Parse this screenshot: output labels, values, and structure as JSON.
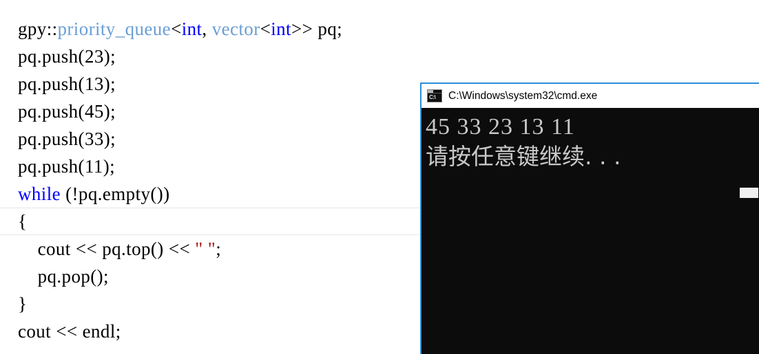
{
  "editor": {
    "language": "cpp",
    "background_color": "#ffffff",
    "foreground_color": "#000000",
    "current_line_highlight_color": "#e6e6e6",
    "token_colors": {
      "keyword": "#0000ff",
      "type": "#6a9fd4",
      "string": "#a31515",
      "plain": "#000000"
    },
    "lines": [
      {
        "id": "line-1",
        "current": false,
        "segments": [
          {
            "text": "gpy::",
            "token": "plain"
          },
          {
            "text": "priority_queue",
            "token": "class"
          },
          {
            "text": "<",
            "token": "plain"
          },
          {
            "text": "int",
            "token": "keyword"
          },
          {
            "text": ", ",
            "token": "plain"
          },
          {
            "text": "vector",
            "token": "class"
          },
          {
            "text": "<",
            "token": "plain"
          },
          {
            "text": "int",
            "token": "keyword"
          },
          {
            "text": ">> pq;",
            "token": "plain"
          }
        ],
        "plain_text": "gpy::priority_queue<int, vector<int>> pq;"
      },
      {
        "id": "line-2",
        "current": false,
        "segments": [
          {
            "text": "pq.push(23);",
            "token": "plain"
          }
        ],
        "plain_text": "pq.push(23);"
      },
      {
        "id": "line-3",
        "current": false,
        "segments": [
          {
            "text": "pq.push(13);",
            "token": "plain"
          }
        ],
        "plain_text": "pq.push(13);"
      },
      {
        "id": "line-4",
        "current": false,
        "segments": [
          {
            "text": "pq.push(45);",
            "token": "plain"
          }
        ],
        "plain_text": "pq.push(45);"
      },
      {
        "id": "line-5",
        "current": false,
        "segments": [
          {
            "text": "pq.push(33);",
            "token": "plain"
          }
        ],
        "plain_text": "pq.push(33);"
      },
      {
        "id": "line-6",
        "current": false,
        "segments": [
          {
            "text": "pq.push(11);",
            "token": "plain"
          }
        ],
        "plain_text": "pq.push(11);"
      },
      {
        "id": "line-7",
        "current": false,
        "segments": [
          {
            "text": "while",
            "token": "keyword"
          },
          {
            "text": " (!pq.empty())",
            "token": "plain"
          }
        ],
        "plain_text": "while (!pq.empty())"
      },
      {
        "id": "line-8",
        "current": true,
        "segments": [
          {
            "text": "{",
            "token": "plain"
          }
        ],
        "plain_text": "{"
      },
      {
        "id": "line-9",
        "current": false,
        "segments": [
          {
            "text": "    cout << pq.top() << ",
            "token": "plain"
          },
          {
            "text": "\" \"",
            "token": "string"
          },
          {
            "text": ";",
            "token": "plain"
          }
        ],
        "plain_text": "    cout << pq.top() << \" \";"
      },
      {
        "id": "line-10",
        "current": false,
        "segments": [
          {
            "text": "    pq.pop();",
            "token": "plain"
          }
        ],
        "plain_text": "    pq.pop();"
      },
      {
        "id": "line-11",
        "current": false,
        "segments": [
          {
            "text": "}",
            "token": "plain"
          }
        ],
        "plain_text": "}"
      },
      {
        "id": "line-12",
        "current": false,
        "segments": [
          {
            "text": "cout << endl;",
            "token": "plain"
          }
        ],
        "plain_text": "cout << endl;"
      }
    ]
  },
  "console_window": {
    "title": "C:\\Windows\\system32\\cmd.exe",
    "icon": "cmd-icon",
    "border_color": "#2a8fd8",
    "titlebar_background": "#ffffff",
    "background_color": "#0c0c0c",
    "text_color": "#c8c8c8",
    "output_lines": [
      "45 33 23 13 11",
      "请按任意键继续. . ."
    ],
    "cursor_visible": true
  }
}
